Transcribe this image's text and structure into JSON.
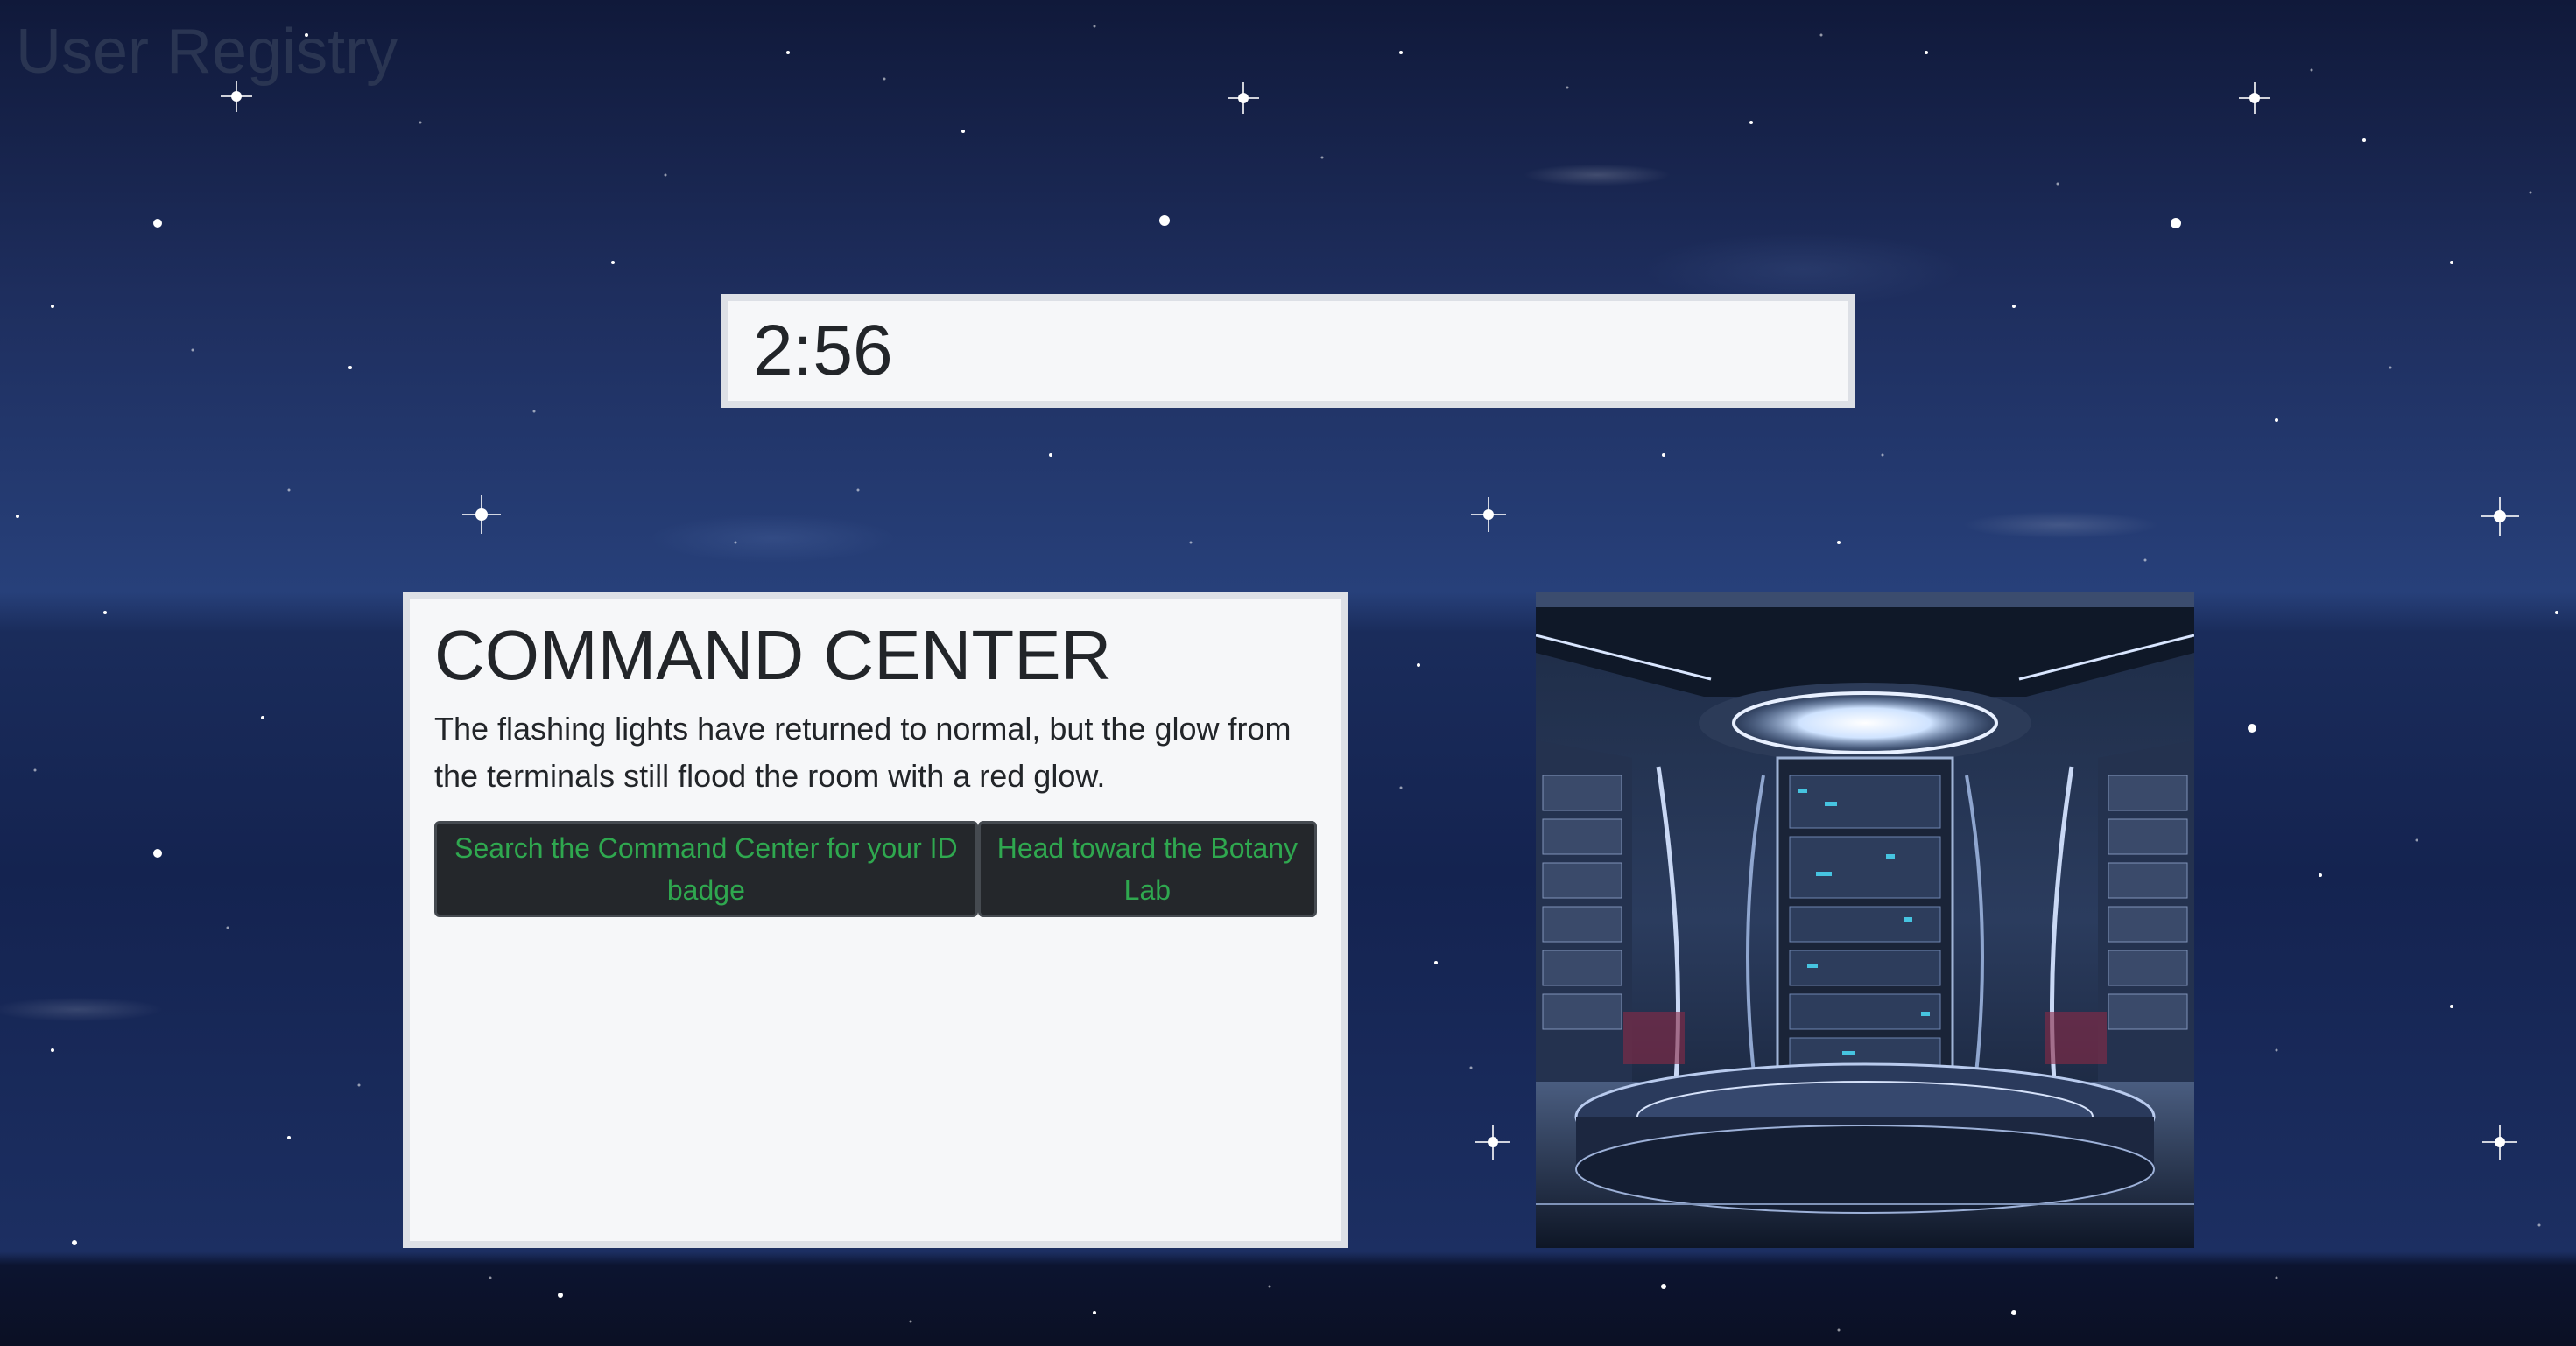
{
  "app": {
    "title": "User Registry"
  },
  "timer": {
    "value": "2:56"
  },
  "room": {
    "title": "COMMAND CENTER",
    "description": "The flashing lights have returned to normal, but the glow from the terminals still flood the room with a red glow.",
    "choices": [
      {
        "label": "Search the Command Center for your ID badge"
      },
      {
        "label": "Head toward the Botany Lab"
      }
    ],
    "image_icon": "command-center-scene"
  },
  "colors": {
    "background": "#1b2a58",
    "panel": "#f6f7f9",
    "panel_border": "#dde0e6",
    "button_bg": "#24272b",
    "button_text": "#2fa84f",
    "title_text": "#2a3552"
  }
}
